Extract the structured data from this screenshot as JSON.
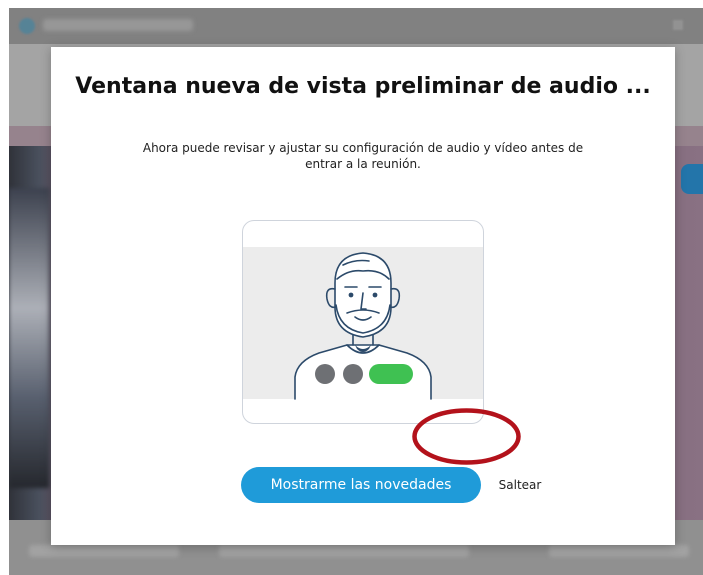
{
  "dialog": {
    "title": "Ventana nueva de vista preliminar de audio ...",
    "body": "Ahora puede revisar y ajustar su configuración de audio y vídeo antes de entrar a la reunión.",
    "primary_button_label": "Mostrarme las novedades",
    "skip_button_label": "Saltear"
  },
  "illustration": {
    "icon": "person-with-beard-icon",
    "controls": [
      {
        "name": "mute-dot",
        "color": "#6e7074"
      },
      {
        "name": "video-dot",
        "color": "#6e7074"
      },
      {
        "name": "join-pill",
        "color": "#3fc152"
      }
    ]
  },
  "colors": {
    "primary": "#1f9bd9",
    "highlight_ellipse": "#b3121b",
    "overlay_text": "#111111"
  }
}
